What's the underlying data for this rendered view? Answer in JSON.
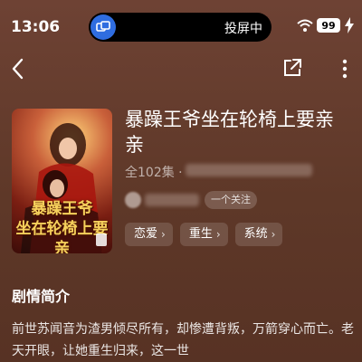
{
  "status": {
    "time": "13:06",
    "cast_label": "投屏中",
    "battery": "99"
  },
  "drama": {
    "title": "暴躁王爷坐在轮椅上要亲亲",
    "episodes": "全102集 ·",
    "follow_tag": "一个关注",
    "cover_text_line1": "暴躁王爷",
    "cover_text_line2": "坐在轮椅上要亲"
  },
  "tags": [
    {
      "label": "恋爱"
    },
    {
      "label": "重生"
    },
    {
      "label": "系统"
    }
  ],
  "synopsis": {
    "heading": "剧情简介",
    "text": "前世苏闻音为渣男倾尽所有，却惨遭背叛，万箭穿心而亡。老天开眼，让她重生归来，这一世"
  },
  "colors": {
    "background": "#5e3828",
    "cast_accent": "#2f6de0"
  },
  "icons": [
    "cast-icon",
    "wifi-icon",
    "battery-icon",
    "charging-icon",
    "back-icon",
    "share-icon",
    "more-icon",
    "chevron-right-icon"
  ]
}
